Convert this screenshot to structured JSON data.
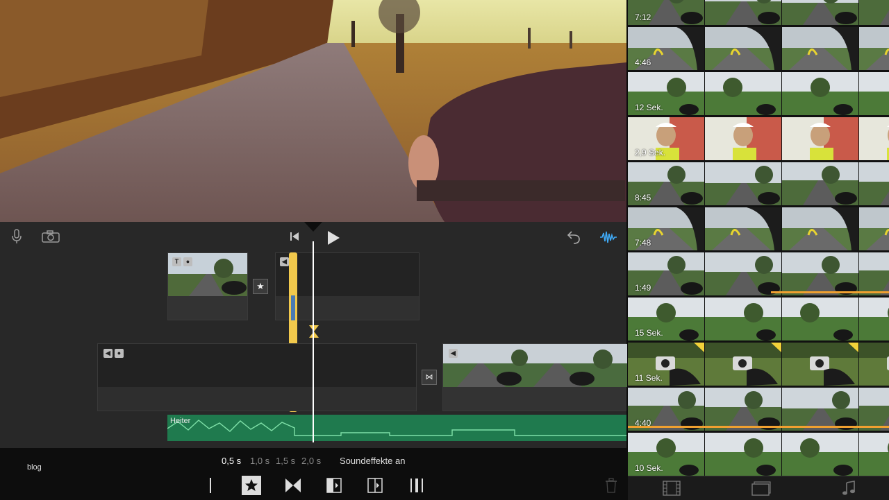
{
  "project": {
    "name": "blog"
  },
  "speed_options": [
    "0,5 s",
    "1,0 s",
    "1,5 s",
    "2,0 s"
  ],
  "sound_effects_label": "Soundeffekte an",
  "audio_clip_label": "Heiter",
  "browser_clips": [
    {
      "duration": "7:12",
      "scene": "road"
    },
    {
      "duration": "4:46",
      "scene": "cycling"
    },
    {
      "duration": "12 Sek.",
      "scene": "field"
    },
    {
      "duration": "2,9 Sek.",
      "scene": "face"
    },
    {
      "duration": "8:45",
      "scene": "road"
    },
    {
      "duration": "7:48",
      "scene": "cycling"
    },
    {
      "duration": "1:49",
      "scene": "road"
    },
    {
      "duration": "15 Sek.",
      "scene": "field"
    },
    {
      "duration": "11 Sek.",
      "scene": "camera"
    },
    {
      "duration": "4:40",
      "scene": "road"
    },
    {
      "duration": "10 Sek.",
      "scene": "field"
    }
  ],
  "icons": {
    "microphone": "microphone-icon",
    "camera": "camera-icon",
    "skip_back": "skip-back-icon",
    "play": "play-icon",
    "undo": "undo-icon",
    "waveform": "audio-waveform-icon",
    "trash": "trash-icon",
    "tab_video": "film-icon",
    "tab_photos": "photos-icon",
    "tab_audio": "music-note-icon"
  },
  "colors": {
    "accent_yellow": "#f2c94c",
    "audio_green": "#1f7a4e",
    "used_orange": "#f0a030",
    "waveform_blue": "#3fa9f5"
  }
}
